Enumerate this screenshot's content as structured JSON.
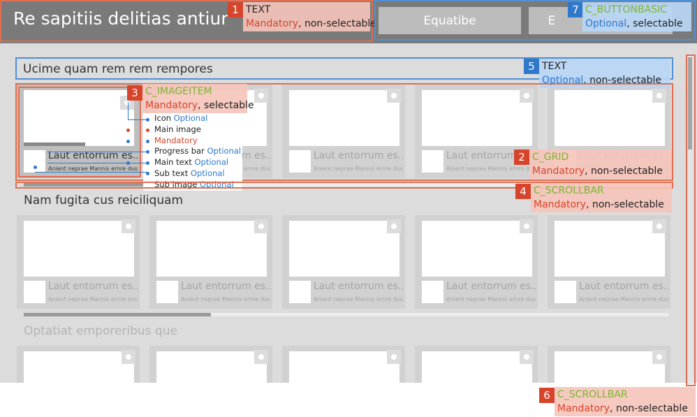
{
  "header": {
    "title": "Re sapitiis delitias antiur",
    "buttons": [
      "Equatibe",
      "E"
    ]
  },
  "sections": [
    {
      "title": "Ucime quam rem rem rempores"
    },
    {
      "title": "Nam fugita cus reiciliquam"
    },
    {
      "title": "Optatiat emporeribus que"
    }
  ],
  "tile": {
    "main_text": "Laut entorrum es...",
    "sub_text": "Anient neprae Mannis ernre dus aui",
    "first_main_text": "Laut entorrum es...",
    "first_sub_text": "Anient neprae Mannis ernre dus aui"
  },
  "scroll": {
    "row1_thumb_fraction": 0.29,
    "row2_thumb_fraction": 0.29,
    "vertical_thumb_fraction": 0.28
  },
  "image_item_parts": {
    "icon": "Icon",
    "main_image": "Main image",
    "progress_bar": "Progress bar",
    "main_text": "Main text",
    "sub_text": "Sub text",
    "sub_image": "Sub image",
    "icon_req": "Optional",
    "main_image_req": "Mandatory",
    "progress_bar_req": "Optional",
    "main_text_req": "Optional",
    "sub_text_req": "Optional",
    "sub_image_req": "Optional"
  },
  "annotations": [
    {
      "num": "1",
      "type": "TEXT",
      "req": "Mandatory",
      "sel": ", non-selectable"
    },
    {
      "num": "2",
      "type": "C_GRID",
      "req": "Mandatory",
      "sel": ", non-selectable"
    },
    {
      "num": "3",
      "type": "C_IMAGEITEM",
      "req": "Mandatory",
      "sel": ", selectable"
    },
    {
      "num": "4",
      "type": "C_SCROLLBAR",
      "req": "Mandatory",
      "sel": ", non-selectable"
    },
    {
      "num": "5",
      "type": "TEXT",
      "req": "Optional",
      "sel": ", non-selectable"
    },
    {
      "num": "6",
      "type": "C_SCROLLBAR",
      "req": "Mandatory",
      "sel": ", non-selectable"
    },
    {
      "num": "7",
      "type": "C_BUTTONBASIC",
      "req": "Optional",
      "sel": ", selectable"
    }
  ],
  "colors": {
    "annotation_red": "#d6452b",
    "annotation_blue": "#2f78cc",
    "type_green": "#7ab52f",
    "header_gray": "#7a7a7a"
  }
}
